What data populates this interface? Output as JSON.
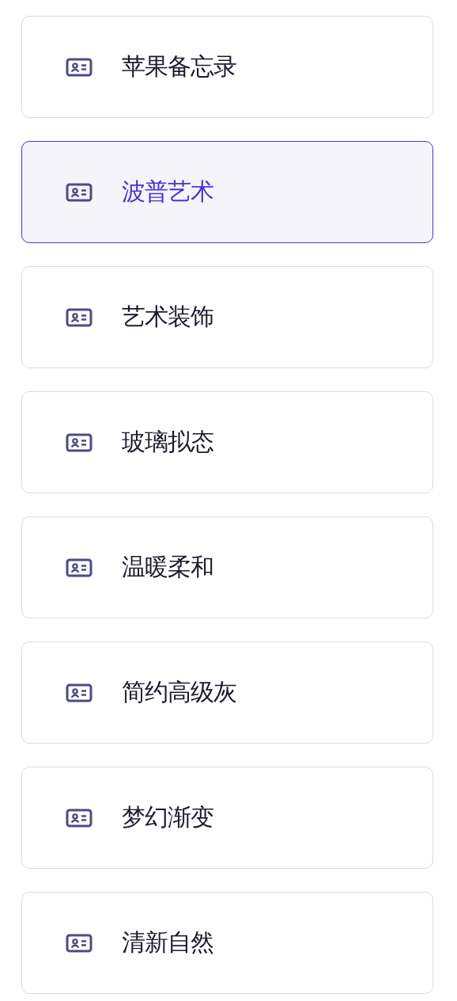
{
  "items": [
    {
      "label": "苹果备忘录",
      "selected": false
    },
    {
      "label": "波普艺术",
      "selected": true
    },
    {
      "label": "艺术装饰",
      "selected": false
    },
    {
      "label": "玻璃拟态",
      "selected": false
    },
    {
      "label": "温暖柔和",
      "selected": false
    },
    {
      "label": "简约高级灰",
      "selected": false
    },
    {
      "label": "梦幻渐变",
      "selected": false
    },
    {
      "label": "清新自然",
      "selected": false
    }
  ]
}
